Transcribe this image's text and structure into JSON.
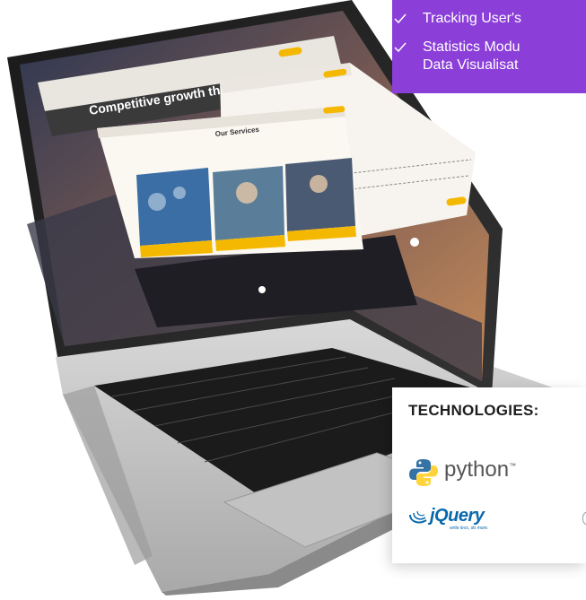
{
  "features": {
    "items": [
      {
        "label": "Tracking User's"
      },
      {
        "label": "Statistics Modu"
      },
      {
        "label": "Data Visualisat"
      }
    ]
  },
  "technologies": {
    "title": "TECHNOLOGIES:",
    "items": [
      {
        "name": "python",
        "trademark": "™",
        "icon": "python-icon"
      },
      {
        "name": "jQuery",
        "tagline": "write less, do more.",
        "icon": "jquery-icon"
      }
    ]
  },
  "laptop_screen": {
    "hero_headline": "Competitive growth throu",
    "section_title": "Our Services"
  },
  "colors": {
    "accent_purple": "#8b3fd8",
    "accent_yellow": "#f5b800",
    "python_blue": "#3572a5",
    "python_yellow": "#ffd43b",
    "jquery_blue": "#0868ac"
  }
}
